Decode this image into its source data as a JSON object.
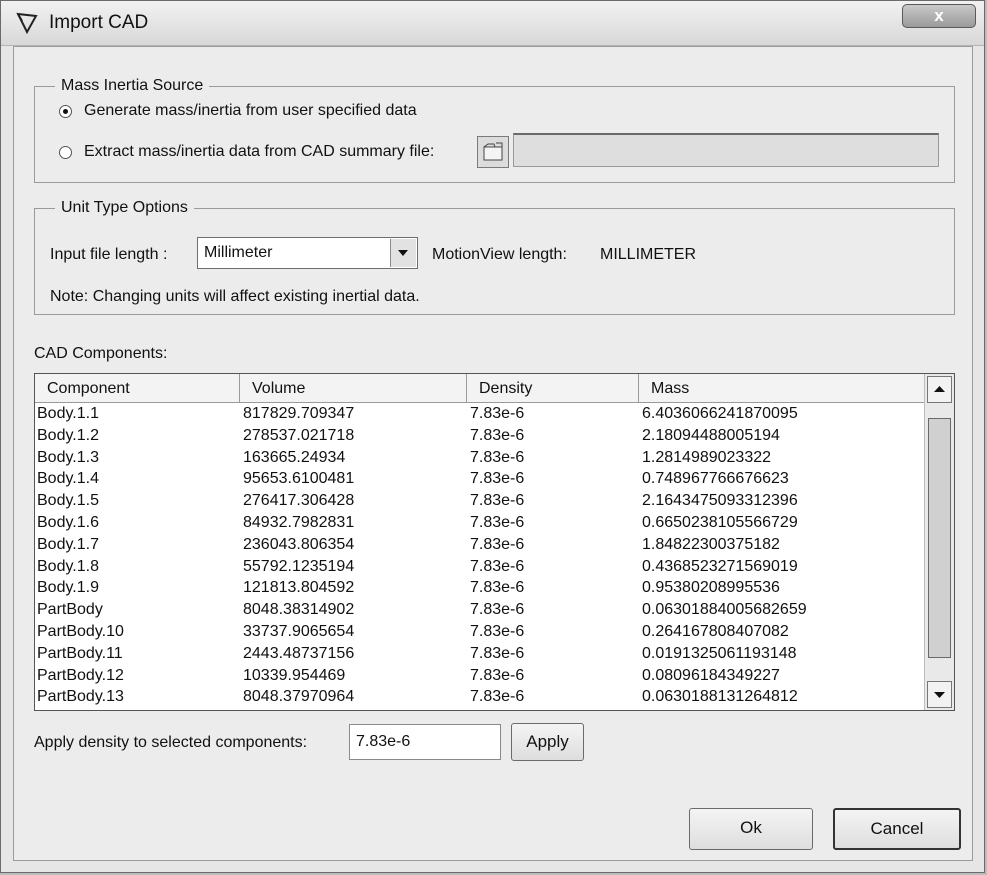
{
  "window": {
    "title": "Import CAD",
    "close_label": "x"
  },
  "mass_inertia": {
    "legend": "Mass Inertia Source",
    "option_user": "Generate mass/inertia from user specified data",
    "option_cad": "Extract mass/inertia data from CAD summary file:",
    "selected": "user",
    "summary_file_value": ""
  },
  "unit_options": {
    "legend": "Unit Type Options",
    "input_length_label": "Input file length :",
    "input_length_value": "Millimeter",
    "motionview_label": "MotionView length:",
    "motionview_value": "MILLIMETER",
    "note": "Note: Changing units will affect existing inertial data."
  },
  "components": {
    "label": "CAD Components:",
    "columns": [
      "Component",
      "Volume",
      "Density",
      "Mass"
    ],
    "rows": [
      [
        "Body.1.1",
        "817829.709347",
        "7.83e-6",
        "6.4036066241870095"
      ],
      [
        "Body.1.2",
        "278537.021718",
        "7.83e-6",
        "2.18094488005194"
      ],
      [
        "Body.1.3",
        "163665.24934",
        "7.83e-6",
        "1.2814989023322"
      ],
      [
        "Body.1.4",
        "95653.6100481",
        "7.83e-6",
        "0.748967766676623"
      ],
      [
        "Body.1.5",
        "276417.306428",
        "7.83e-6",
        "2.1643475093312396"
      ],
      [
        "Body.1.6",
        "84932.7982831",
        "7.83e-6",
        "0.6650238105566729"
      ],
      [
        "Body.1.7",
        "236043.806354",
        "7.83e-6",
        "1.84822300375182"
      ],
      [
        "Body.1.8",
        "55792.1235194",
        "7.83e-6",
        "0.4368523271569019"
      ],
      [
        "Body.1.9",
        "121813.804592",
        "7.83e-6",
        "0.95380208995536"
      ],
      [
        "PartBody",
        "8048.38314902",
        "7.83e-6",
        "0.06301884005682659"
      ],
      [
        "PartBody.10",
        "33737.9065654",
        "7.83e-6",
        "0.264167808407082"
      ],
      [
        "PartBody.11",
        "2443.48737156",
        "7.83e-6",
        "0.0191325061193148"
      ],
      [
        "PartBody.12",
        "10339.954469",
        "7.83e-6",
        "0.08096184349227"
      ],
      [
        "PartBody.13",
        "8048.37970964",
        "7.83e-6",
        "0.0630188131264812"
      ]
    ]
  },
  "density": {
    "label": "Apply density to selected components:",
    "value": "7.83e-6",
    "apply_label": "Apply"
  },
  "footer": {
    "ok_label": "Ok",
    "cancel_label": "Cancel"
  }
}
